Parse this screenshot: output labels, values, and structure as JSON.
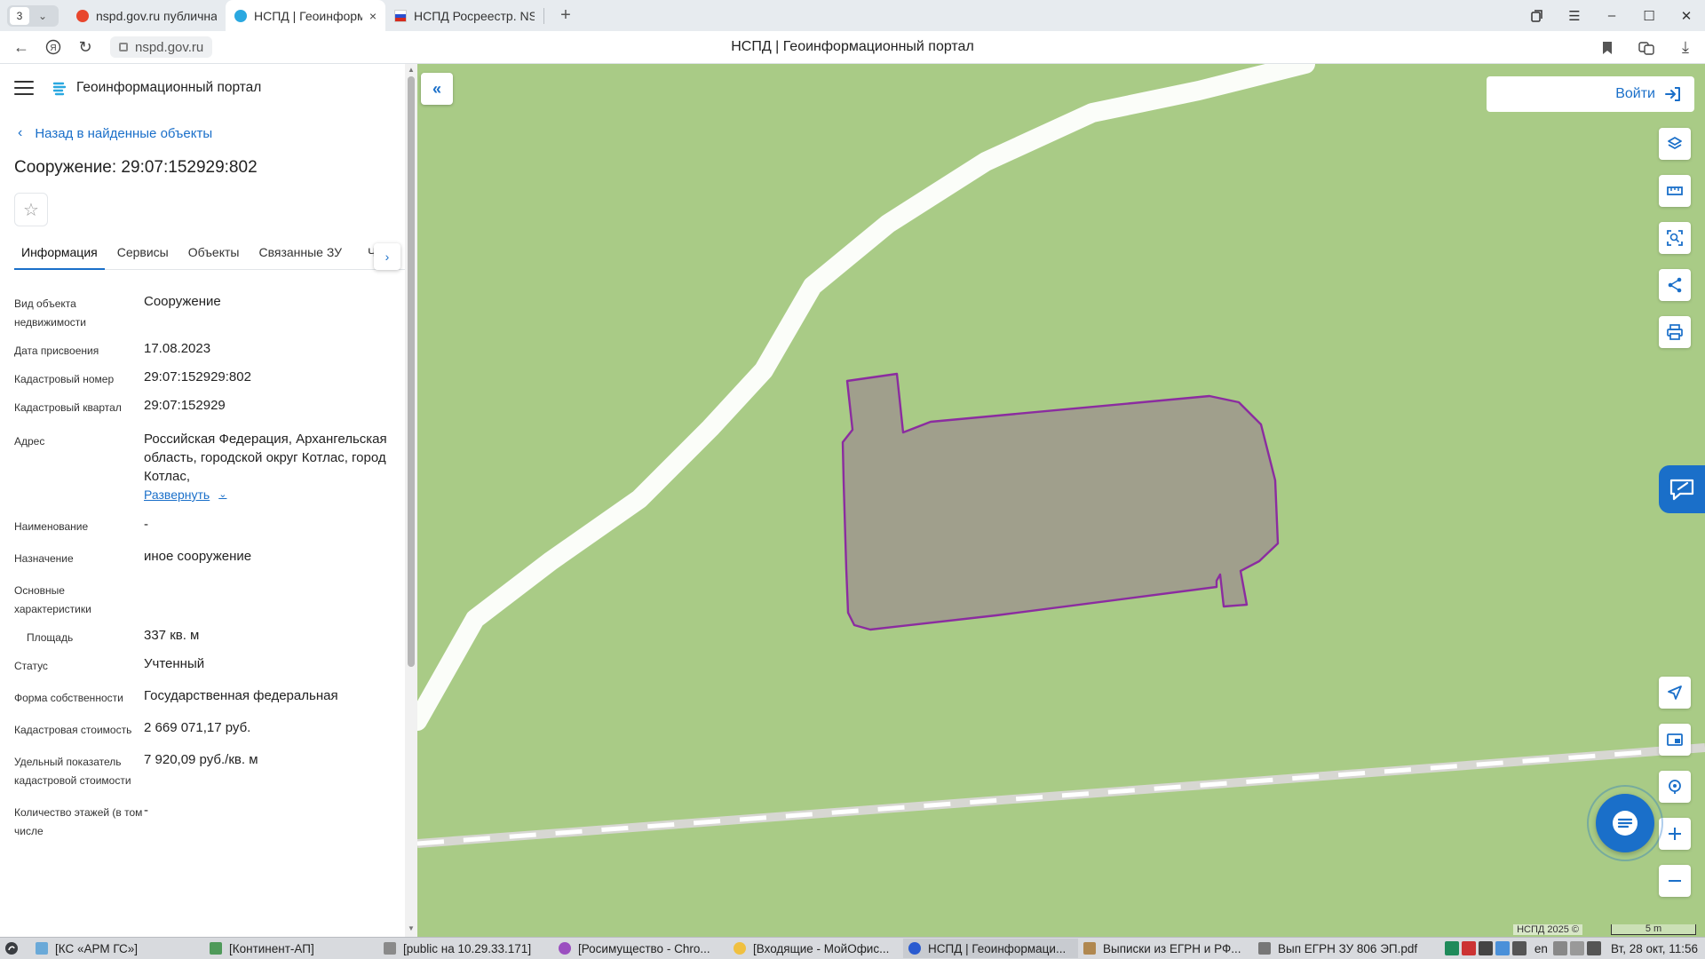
{
  "browser": {
    "tab_count": "3",
    "tabs": [
      {
        "title": "nspd.gov.ru публичная",
        "favicon_color": "#e8462d",
        "active": false
      },
      {
        "title": "НСПД | Геоинформа",
        "favicon_color": "#2aa8e0",
        "active": true
      },
      {
        "title": "НСПД Росреестр. NSPD",
        "favicon_color": "#d52b1e",
        "active": false
      }
    ],
    "url": "nspd.gov.ru",
    "page_title": "НСПД | Геоинформационный портал"
  },
  "app": {
    "name": "Геоинформационный портал",
    "back_label": "Назад в найденные объекты",
    "object_title": "Сооружение: 29:07:152929:802",
    "tabs": [
      "Информация",
      "Сервисы",
      "Объекты",
      "Связанные ЗУ"
    ],
    "tab_peek": "Ч",
    "attributes": [
      {
        "label": "Вид объекта недвижимости",
        "value": "Сооружение"
      },
      {
        "label": "Дата присвоения",
        "value": "17.08.2023"
      },
      {
        "label": "Кадастровый номер",
        "value": "29:07:152929:802"
      },
      {
        "label": "Кадастровый квартал",
        "value": "29:07:152929"
      },
      {
        "label": "Адрес",
        "value": "Российская Федерация, Архангельская область, городской округ Котлас, город Котлас,"
      },
      {
        "label": "Наименование",
        "value": "-"
      },
      {
        "label": "Назначение",
        "value": "иное сооружение"
      },
      {
        "label": "Основные характеристики",
        "value": ""
      },
      {
        "label": "Площадь",
        "value": "337 кв. м"
      },
      {
        "label": "Статус",
        "value": "Учтенный"
      },
      {
        "label": "Форма собственности",
        "value": "Государственная федеральная"
      },
      {
        "label": "Кадастровая стоимость",
        "value": "2 669 071,17 руб."
      },
      {
        "label": "Удельный показатель кадастровой стоимости",
        "value": "7 920,09 руб./кв. м"
      },
      {
        "label": "Количество этажей (в том числе",
        "value": "-"
      }
    ],
    "expand_label": "Развернуть"
  },
  "map": {
    "login_label": "Войти",
    "copyright": "НСПД 2025 ©",
    "scale_label": "5 m",
    "colors": {
      "background": "#a9cb86",
      "road": "#ffffff",
      "parcel_fill": "#a0a08a",
      "parcel_stroke": "#8b2ca0",
      "accent": "#1a6fc9"
    },
    "toolbar_icons": [
      "layers-icon",
      "ruler-icon",
      "select-area-icon",
      "share-icon",
      "print-icon"
    ],
    "bottom_icons": [
      "locate-icon",
      "minimap-icon",
      "geolocation-icon",
      "zoom-in-icon",
      "zoom-out-icon"
    ]
  },
  "taskbar": {
    "items": [
      {
        "label": "[КС «АРМ ГС»]",
        "color": "#6aa9d8"
      },
      {
        "label": "[Континент-АП]",
        "color": "#4f9a5a"
      },
      {
        "label": "[public на 10.29.33.171]",
        "color": "#8a8a8a"
      },
      {
        "label": "[Росимущество - Chro...",
        "color": "#9b4fc0"
      },
      {
        "label": "[Входящие - МойОфис...",
        "color": "#f0c040"
      },
      {
        "label": "НСПД | Геоинформаци...",
        "color": "#2a5bd0"
      },
      {
        "label": "Выписки из ЕГРН и РФ...",
        "color": "#b08850"
      },
      {
        "label": "Вып ЕГРН ЗУ 806 ЭП.pdf",
        "color": "#777777"
      }
    ],
    "lang": "en",
    "clock": "Вт, 28 окт, 11:56"
  }
}
